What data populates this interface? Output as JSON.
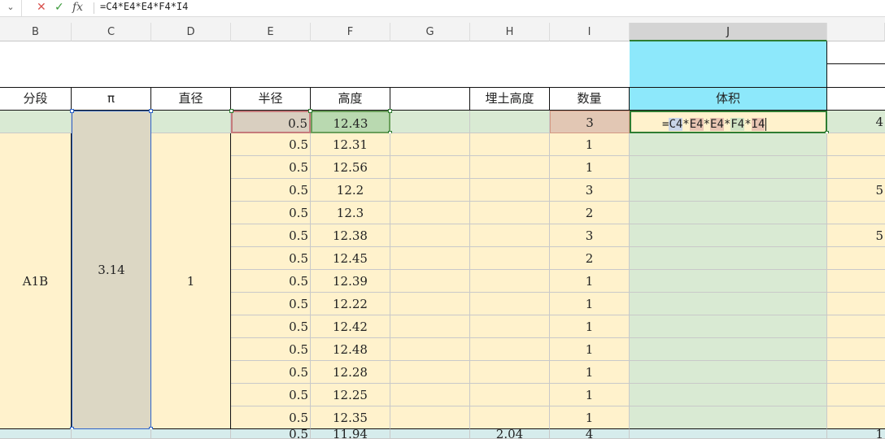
{
  "formula_bar": {
    "namebox_icon": "chevron-down-icon",
    "cancel_glyph": "✕",
    "confirm_glyph": "✓",
    "fx_label": "fx",
    "formula": "=C4*E4*E4*F4*I4"
  },
  "columns": [
    "B",
    "C",
    "D",
    "E",
    "F",
    "G",
    "H",
    "I",
    "J"
  ],
  "header_row": {
    "B": "分段",
    "C": "π",
    "D": "直径",
    "E": "半径",
    "F": "高度",
    "G": "",
    "H": "埋土高度",
    "I": "数量",
    "J": "体积"
  },
  "merged": {
    "segment": "A1B",
    "pi": "3.14",
    "diameter": "1"
  },
  "active_cell": {
    "prefix": "=",
    "refs": [
      {
        "text": "C4",
        "op": "*"
      },
      {
        "text": "E4",
        "op": "*"
      },
      {
        "text": "E4",
        "op": "*"
      },
      {
        "text": "F4",
        "op": "*"
      },
      {
        "text": "I4",
        "op": ""
      }
    ]
  },
  "rows": [
    {
      "radius": "0.5",
      "height": "12.43",
      "qty": "3"
    },
    {
      "radius": "0.5",
      "height": "12.31",
      "qty": "1"
    },
    {
      "radius": "0.5",
      "height": "12.56",
      "qty": "1"
    },
    {
      "radius": "0.5",
      "height": "12.2",
      "qty": "3"
    },
    {
      "radius": "0.5",
      "height": "12.3",
      "qty": "2"
    },
    {
      "radius": "0.5",
      "height": "12.38",
      "qty": "3"
    },
    {
      "radius": "0.5",
      "height": "12.45",
      "qty": "2"
    },
    {
      "radius": "0.5",
      "height": "12.39",
      "qty": "1"
    },
    {
      "radius": "0.5",
      "height": "12.22",
      "qty": "1"
    },
    {
      "radius": "0.5",
      "height": "12.42",
      "qty": "1"
    },
    {
      "radius": "0.5",
      "height": "12.48",
      "qty": "1"
    },
    {
      "radius": "0.5",
      "height": "12.28",
      "qty": "1"
    },
    {
      "radius": "0.5",
      "height": "12.25",
      "qty": "1"
    },
    {
      "radius": "0.5",
      "height": "12.35",
      "qty": "1"
    }
  ],
  "partial_row": {
    "radius": "0.5",
    "height": "11.94",
    "buried": "2.04",
    "qty": "4"
  },
  "edge_values": [
    "4",
    "5",
    "5",
    "1"
  ]
}
